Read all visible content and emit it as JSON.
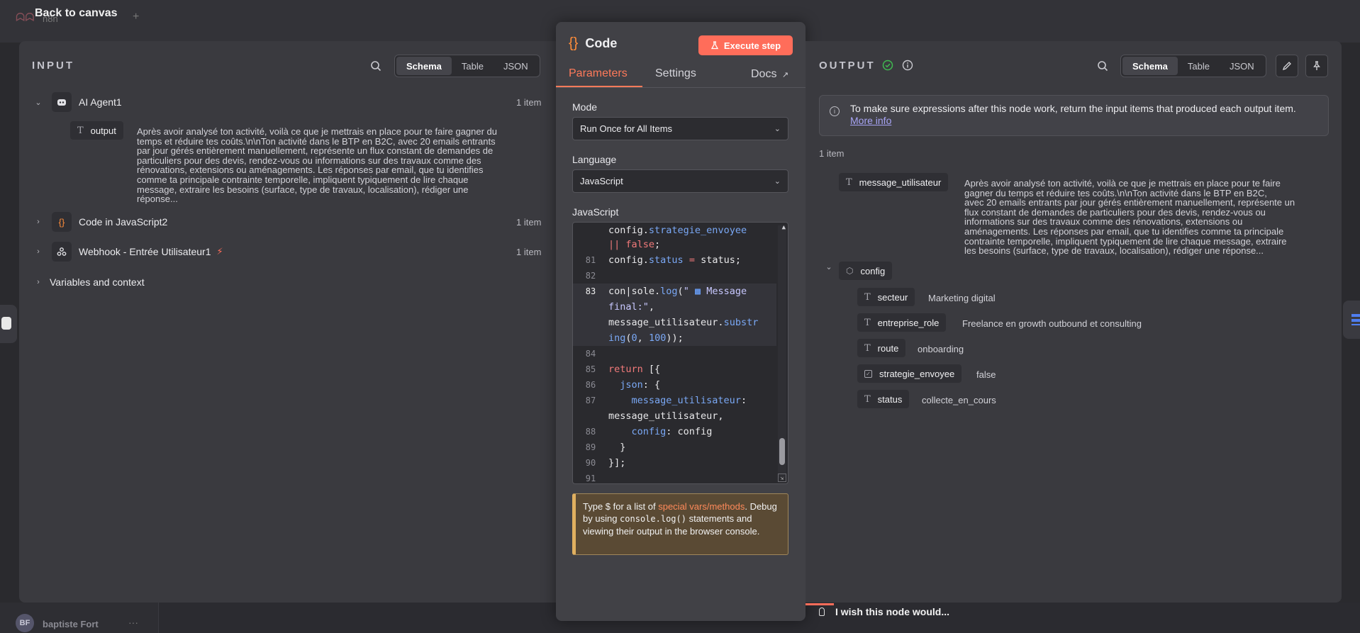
{
  "app": {
    "back_label": "Back to canvas",
    "bg_tab": "n8n",
    "user_initials": "BF",
    "user_name": "baptiste Fort",
    "user_more": "···"
  },
  "input_panel": {
    "title": "INPUT",
    "view_tabs": [
      "Schema",
      "Table",
      "JSON"
    ],
    "nodes": [
      {
        "label": "AI Agent1",
        "icon": "robot-icon",
        "count": "1 item"
      },
      {
        "label": "Code in JavaScript2",
        "icon": "braces-icon",
        "count": "1 item"
      },
      {
        "label": "Webhook - Entrée Utilisateur1",
        "icon": "webhook-icon",
        "count": "1 item"
      },
      {
        "label": "Variables and context"
      }
    ],
    "output_field": {
      "name": "output",
      "lines": [
        "Après avoir analysé ton activité, voilà ce que je mettrais en place pour te faire gagner du",
        "temps et réduire tes coûts.\\n\\nTon activité dans le BTP en B2C, avec 20 emails entrants",
        "par jour gérés entièrement manuellement, représente un flux constant de demandes de",
        "particuliers pour des devis, rendez-vous ou informations sur des travaux comme des",
        "rénovations, extensions ou aménagements. Les réponses par email, que tu identifies",
        "comme ta principale contrainte temporelle, impliquent typiquement de lire chaque",
        "message, extraire les besoins (surface, type de travaux, localisation), rédiger une",
        "réponse..."
      ]
    }
  },
  "code_panel": {
    "title": "Code",
    "execute_label": "Execute step",
    "tabs": [
      "Parameters",
      "Settings",
      "Docs"
    ],
    "mode_label": "Mode",
    "mode_value": "Run Once for All Items",
    "language_label": "Language",
    "language_value": "JavaScript",
    "editor_label": "JavaScript",
    "hint": {
      "part1": "Type $ for a list of ",
      "special": "special vars/methods",
      "part2": ". Debug by using ",
      "code": "console.log()",
      "part3": " statements and viewing their output in the browser console."
    }
  },
  "output_panel": {
    "title": "OUTPUT",
    "view_tabs": [
      "Schema",
      "Table",
      "JSON"
    ],
    "info_text": "To make sure expressions after this node work, return the input items that produced each output item.",
    "info_link": "More info",
    "item_count": "1 item",
    "message_field": {
      "name": "message_utilisateur",
      "lines": [
        "Après avoir analysé ton activité, voilà ce que je mettrais en place pour te faire",
        "gagner du temps et réduire tes coûts.\\n\\nTon activité dans le BTP en B2C,",
        "avec 20 emails entrants par jour gérés entièrement manuellement, représente un",
        "flux constant de demandes de particuliers pour des devis, rendez-vous ou",
        "informations sur des travaux comme des rénovations, extensions ou",
        "aménagements. Les réponses par email, que tu identifies comme ta principale",
        "contrainte temporelle, impliquent typiquement de lire chaque message, extraire",
        "les besoins (surface, type de travaux, localisation), rédiger une réponse..."
      ]
    },
    "config": {
      "name": "config",
      "fields": [
        {
          "name": "secteur",
          "value": "Marketing digital",
          "type": "T"
        },
        {
          "name": "entreprise_role",
          "value": "Freelance en growth outbound et consulting",
          "type": "T"
        },
        {
          "name": "route",
          "value": "onboarding",
          "type": "T"
        },
        {
          "name": "strategie_envoyee",
          "value": "false",
          "type": "bool"
        },
        {
          "name": "status",
          "value": "collecte_en_cours",
          "type": "T"
        }
      ]
    }
  },
  "footer": {
    "wish": "I wish this node would..."
  },
  "colors": {
    "accent": "#ff6d5a",
    "link": "#a7a4f5",
    "success": "#3fb950"
  }
}
